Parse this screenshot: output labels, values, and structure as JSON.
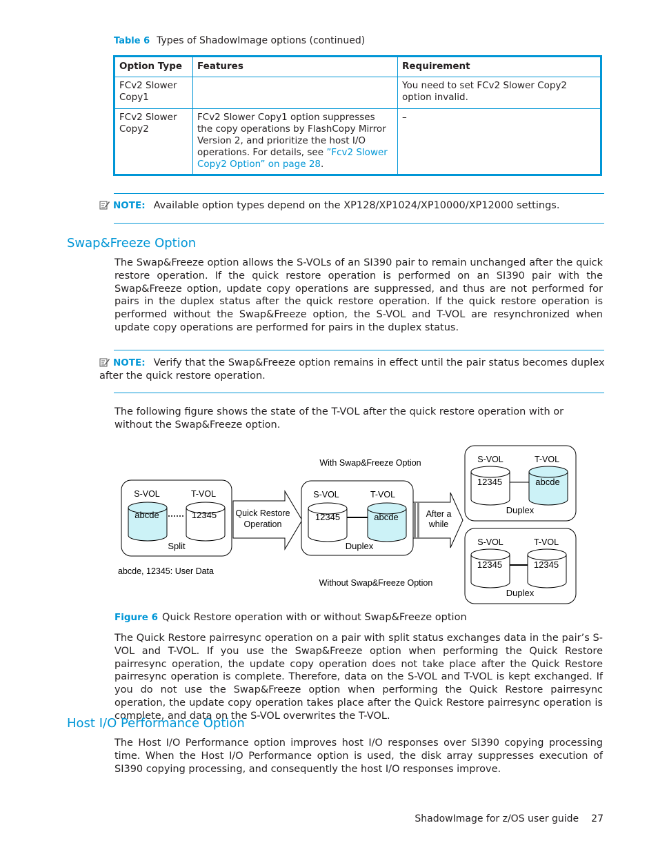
{
  "table": {
    "caption_label": "Table 6",
    "caption_text": "Types of ShadowImage options (continued)",
    "headers": [
      "Option Type",
      "Features",
      "Requirement"
    ],
    "rows": [
      {
        "option_type": "FCv2 Slower Copy1",
        "features": "",
        "requirement": "You need to set FCv2 Slower Copy2 option invalid."
      },
      {
        "option_type": "FCv2 Slower Copy2",
        "features": "FCv2 Slower Copy1 option suppresses the copy operations by FlashCopy Mirror Version 2, and prioritize the host I/O operations. For details, see ",
        "features_link": "”Fcv2 Slower Copy2 Option” on page 28",
        "features_tail": ".",
        "requirement": "–"
      }
    ]
  },
  "note1": {
    "icon": "note-icon",
    "label": "NOTE:",
    "text": "Available option types depend on the XP128/XP1024/XP10000/XP12000 settings."
  },
  "section_swap": {
    "heading": "Swap&Freeze Option",
    "para1": "The Swap&Freeze option allows the S-VOLs of an SI390 pair to remain unchanged after the quick restore operation. If the quick restore operation is performed on an SI390 pair with the Swap&Freeze option, update copy operations are suppressed, and thus are not performed for pairs in the duplex status after the quick restore operation. If the quick restore operation is performed without the Swap&Freeze option, the S-VOL and T-VOL are resynchronized when update copy operations are performed for pairs in the duplex status."
  },
  "note2": {
    "icon": "note-icon",
    "label": "NOTE:",
    "text": "Verify that the Swap&Freeze option remains in effect until the pair status becomes duplex after the quick restore operation."
  },
  "figure_intro": "The following figure shows the state of the T-VOL after the quick restore operation with or without the Swap&Freeze option.",
  "figure": {
    "split_box": {
      "svol_label": "S-VOL",
      "tvol_label": "T-VOL",
      "svol_data": "abcde",
      "tvol_data": "12345",
      "status": "Split"
    },
    "arrow1": {
      "line1": "Quick Restore",
      "line2": "Operation"
    },
    "duplex_box": {
      "svol_label": "S-VOL",
      "tvol_label": "T-VOL",
      "svol_data": "12345",
      "tvol_data": "abcde",
      "status": "Duplex"
    },
    "arrow2": {
      "line1": "After a",
      "line2": "while"
    },
    "with_label": "With Swap&Freeze Option",
    "without_label": "Without Swap&Freeze Option",
    "with_box": {
      "svol_label": "S-VOL",
      "tvol_label": "T-VOL",
      "svol_data": "12345",
      "tvol_data": "abcde",
      "status": "Duplex"
    },
    "without_box": {
      "svol_label": "S-VOL",
      "tvol_label": "T-VOL",
      "svol_data": "12345",
      "tvol_data": "12345",
      "status": "Duplex"
    },
    "legend": "abcde, 12345: User Data",
    "highlight_color": "#ccf2f7"
  },
  "figure_caption": {
    "label": "Figure 6",
    "text": "Quick Restore operation with or without Swap&Freeze option"
  },
  "para_after_figure": "The Quick Restore pairresync operation on a pair with split status exchanges data in the pair’s S-VOL and T-VOL. If you use the Swap&Freeze option when performing the Quick Restore pairresync operation, the update copy operation does not take place after the Quick Restore pairresync operation is complete. Therefore, data on the S-VOL and T-VOL is kept exchanged. If you do not use the Swap&Freeze option when performing the Quick Restore pairresync operation, the update copy operation takes place after the Quick Restore pairresync operation is complete, and data on the S-VOL overwrites the T-VOL.",
  "section_hostio": {
    "heading": "Host I/O Performance Option",
    "para1": "The Host I/O Performance option improves host I/O responses over SI390 copying processing time. When the Host I/O Performance option is used, the disk array suppresses execution of SI390 copying processing, and consequently the host I/O responses improve."
  },
  "footer": {
    "title": "ShadowImage for z/OS user guide",
    "page": "27"
  },
  "colors": {
    "accent": "#0096d6",
    "text": "#231f20"
  }
}
